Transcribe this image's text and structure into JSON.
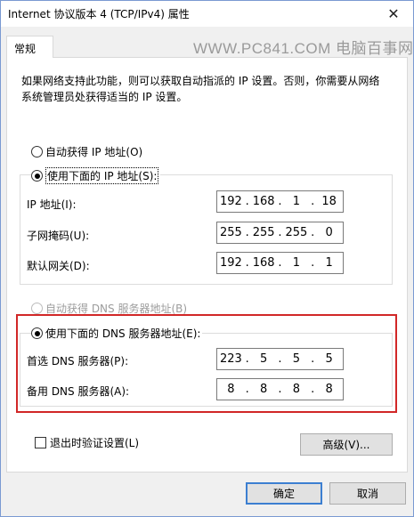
{
  "window": {
    "title": "Internet 协议版本 4 (TCP/IPv4) 属性",
    "close_glyph": "✕"
  },
  "tab": {
    "label": "常规"
  },
  "watermark": "WWW.PC841.COM 电脑百事网",
  "description": "如果网络支持此功能，则可以获取自动指派的 IP 设置。否则，你需要从网络系统管理员处获得适当的 IP 设置。",
  "ip": {
    "auto_label": "自动获得 IP 地址(O)",
    "manual_label": "使用下面的 IP 地址(S):",
    "address_label": "IP 地址(I):",
    "address": [
      "192",
      "168",
      "1",
      "18"
    ],
    "subnet_label": "子网掩码(U):",
    "subnet": [
      "255",
      "255",
      "255",
      "0"
    ],
    "gateway_label": "默认网关(D):",
    "gateway": [
      "192",
      "168",
      "1",
      "1"
    ]
  },
  "dns": {
    "auto_label": "自动获得 DNS 服务器地址(B)",
    "manual_label": "使用下面的 DNS 服务器地址(E):",
    "preferred_label": "首选 DNS 服务器(P):",
    "preferred": [
      "223",
      "5",
      "5",
      "5"
    ],
    "alternate_label": "备用 DNS 服务器(A):",
    "alternate": [
      "8",
      "8",
      "8",
      "8"
    ]
  },
  "validate_label": "退出时验证设置(L)",
  "advanced_label": "高级(V)...",
  "ok_label": "确定",
  "cancel_label": "取消",
  "highlight_color": "#d12727"
}
